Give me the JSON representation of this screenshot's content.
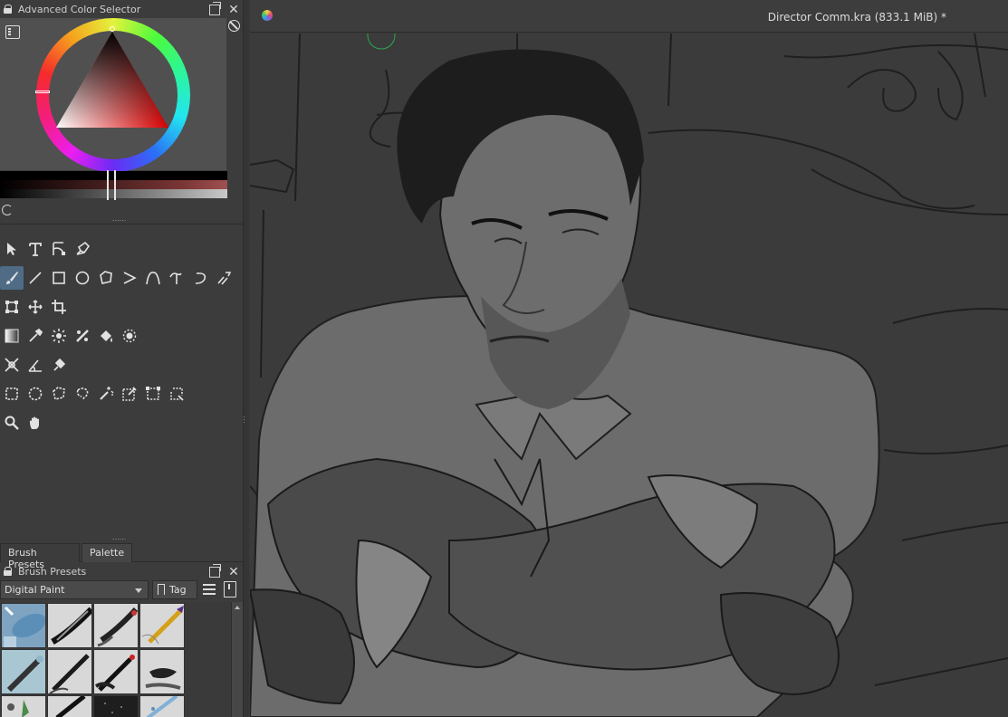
{
  "color_selector": {
    "title": "Advanced Color Selector"
  },
  "toolbox": {
    "rows": [
      [
        "select-shapes",
        "text",
        "edit-shapes",
        "calligraphy"
      ],
      [
        "freehand-brush",
        "line",
        "rectangle",
        "ellipse",
        "polygon",
        "polyline",
        "bezier",
        "freehand-path",
        "dynamic-brush",
        "multibrush"
      ],
      [
        "transform",
        "move",
        "crop"
      ],
      [
        "gradient",
        "color-sampler",
        "colorize-mask",
        "smart-patch",
        "fill",
        "enclose-fill"
      ],
      [
        "assistant",
        "measure",
        "reference-images"
      ],
      [
        "rect-select",
        "ellipse-select",
        "polygon-select",
        "freehand-select",
        "contiguous-select",
        "similar-select",
        "bezier-select",
        "magnetic-select"
      ],
      [
        "zoom",
        "pan"
      ]
    ]
  },
  "tabs": {
    "brush_presets": "Brush Presets",
    "palette": "Palette"
  },
  "brush_presets": {
    "title": "Brush Presets",
    "filter_value": "Digital Paint",
    "tag_label": "Tag"
  },
  "document": {
    "name": "Director Comm.kra (833.1 MiB) *"
  },
  "colors": {
    "accent": "#4f6b86",
    "dock_bg": "#3c3c3c",
    "canvas_bg": "#3b3b3b"
  }
}
